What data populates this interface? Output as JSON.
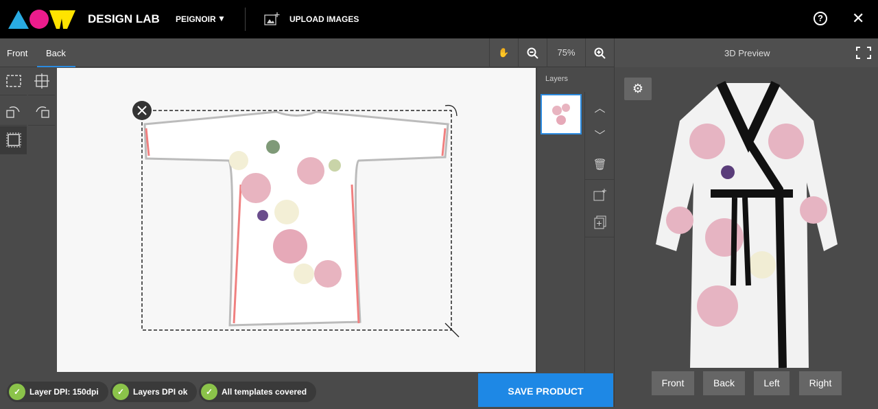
{
  "header": {
    "brand": "DESIGN LAB",
    "product": "PEIGNOIR",
    "upload_label": "UPLOAD IMAGES",
    "help": "?",
    "close": "✕"
  },
  "tabs": [
    {
      "label": "Front",
      "active": false
    },
    {
      "label": "Back",
      "active": true
    }
  ],
  "toolbar": {
    "zoom": "75%"
  },
  "layers": {
    "title": "Layers"
  },
  "preview": {
    "title": "3D Preview",
    "views": [
      "Front",
      "Back",
      "Left",
      "Right"
    ]
  },
  "status": [
    {
      "label": "Layer DPI: 150dpi"
    },
    {
      "label": "Layers DPI ok"
    },
    {
      "label": "All templates covered"
    }
  ],
  "save_label": "SAVE PRODUCT",
  "colors": {
    "accent": "#1e88e5",
    "ok": "#8bc34a"
  }
}
